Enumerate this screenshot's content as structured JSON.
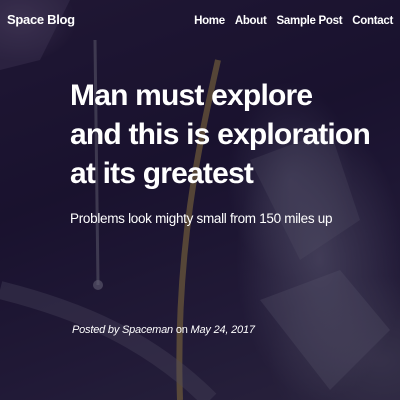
{
  "navbar": {
    "brand": "Space Blog",
    "links": [
      {
        "label": "Home"
      },
      {
        "label": "About"
      },
      {
        "label": "Sample Post"
      },
      {
        "label": "Contact"
      }
    ]
  },
  "post": {
    "title": "Man must explore and this is exploration at its greatest",
    "subtitle": "Problems look mighty small from 150 miles up",
    "meta": {
      "posted_by": "Posted by",
      "author": "Spaceman",
      "on": "on",
      "date": "May 24, 2017"
    }
  },
  "colors": {
    "text": "#ffffff",
    "background": "#1e1636"
  }
}
